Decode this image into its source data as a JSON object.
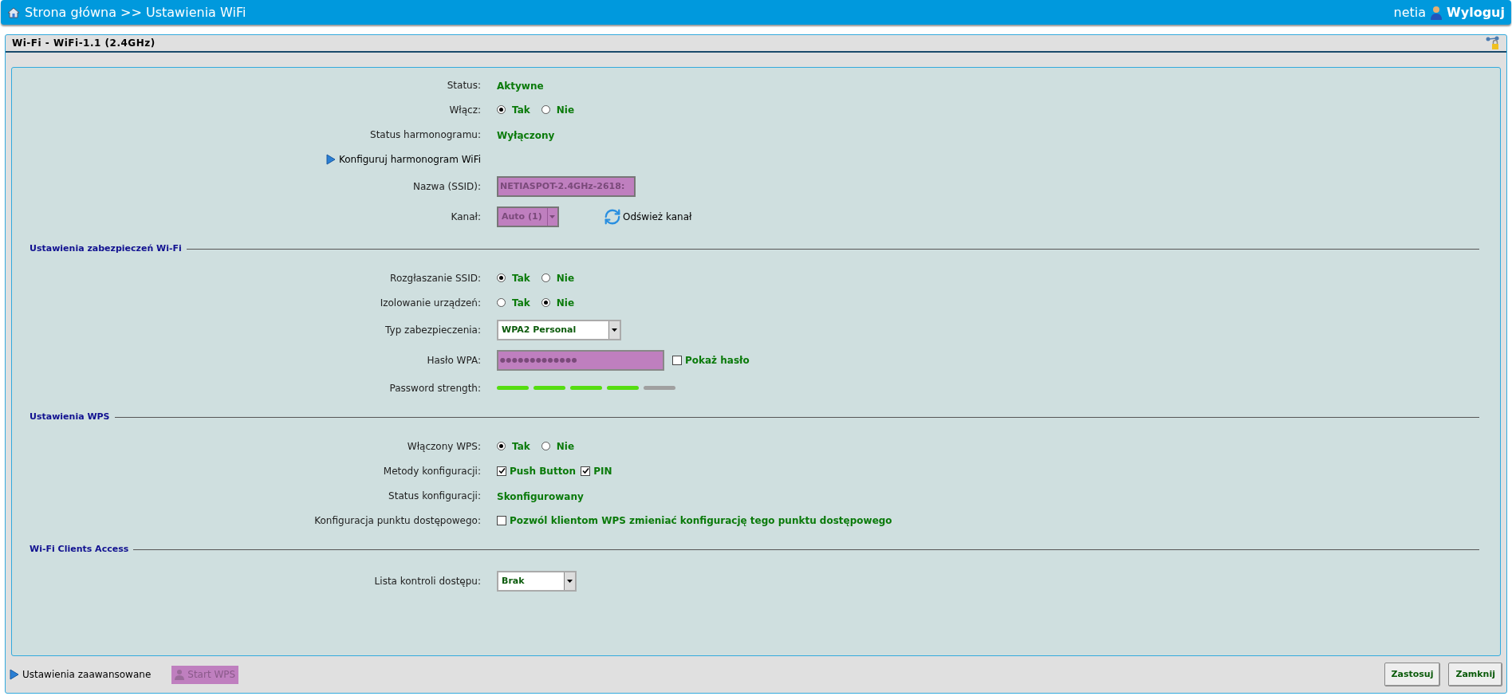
{
  "header": {
    "breadcrumb": "Strona główna >> Ustawienia WiFi",
    "user": "netia",
    "logout": "Wyloguj"
  },
  "panel": {
    "title": "Wi-Fi - WiFi-1.1 (2.4GHz)",
    "sections": [
      {
        "rows": [
          {
            "kind": "text",
            "label": "Status:",
            "value": "Aktywne"
          },
          {
            "kind": "radio",
            "label": "Włącz:",
            "options": [
              {
                "label": "Tak",
                "selected": true
              },
              {
                "label": "Nie",
                "selected": false
              }
            ]
          },
          {
            "kind": "text",
            "label": "Status harmonogramu:",
            "value": "Wyłączony"
          },
          {
            "kind": "link",
            "label": "Konfiguruj harmonogram WiFi"
          },
          {
            "kind": "input",
            "label": "Nazwa (SSID):",
            "value": "NETIASPOT-2.4GHz-2618:",
            "disabled": true
          },
          {
            "kind": "select",
            "label": "Kanał:",
            "value": "Auto (1)",
            "disabled": true,
            "action": "Odśwież kanał"
          }
        ]
      },
      {
        "title": "Ustawienia zabezpieczeń Wi-Fi",
        "rows": [
          {
            "kind": "radio",
            "label": "Rozgłaszanie SSID:",
            "options": [
              {
                "label": "Tak",
                "selected": true
              },
              {
                "label": "Nie",
                "selected": false
              }
            ]
          },
          {
            "kind": "radio",
            "label": "Izolowanie urządzeń:",
            "options": [
              {
                "label": "Tak",
                "selected": false
              },
              {
                "label": "Nie",
                "selected": true
              }
            ]
          },
          {
            "kind": "select",
            "label": "Typ zabezpieczenia:",
            "value": "WPA2 Personal",
            "disabled": false
          },
          {
            "kind": "password",
            "label": "Hasło WPA:",
            "value": "●●●●●●●●●●●●●",
            "options": [
              {
                "label": "Pokaż hasło",
                "checked": false
              }
            ]
          },
          {
            "kind": "strength",
            "label": "Password strength:",
            "level": 0.8
          }
        ]
      },
      {
        "title": "Ustawienia WPS",
        "rows": [
          {
            "kind": "radio",
            "label": "Włączony WPS:",
            "options": [
              {
                "label": "Tak",
                "selected": true
              },
              {
                "label": "Nie",
                "selected": false
              }
            ]
          },
          {
            "kind": "checkboxes",
            "label": "Metody konfiguracji:",
            "options": [
              {
                "label": "Push Button",
                "checked": true
              },
              {
                "label": "PIN",
                "checked": true
              }
            ]
          },
          {
            "kind": "text",
            "label": "Status konfiguracji:",
            "value": "Skonfigurowany"
          },
          {
            "kind": "checkboxes",
            "label": "Konfiguracja punktu dostępowego:",
            "options": [
              {
                "label": "Pozwól klientom WPS zmieniać konfigurację tego punktu dostępowego",
                "checked": false
              }
            ]
          }
        ]
      },
      {
        "title": "Wi-Fi Clients Access",
        "rows": [
          {
            "kind": "select",
            "label": "Lista kontroli dostępu:",
            "value": "Brak",
            "disabled": false
          }
        ]
      }
    ]
  },
  "footer": {
    "advanced_link": "Ustawienia zaawansowane",
    "wps_button": {
      "label": "Start WPS",
      "disabled": true
    },
    "buttons": [
      "Zastosuj",
      "Zamknij"
    ]
  }
}
